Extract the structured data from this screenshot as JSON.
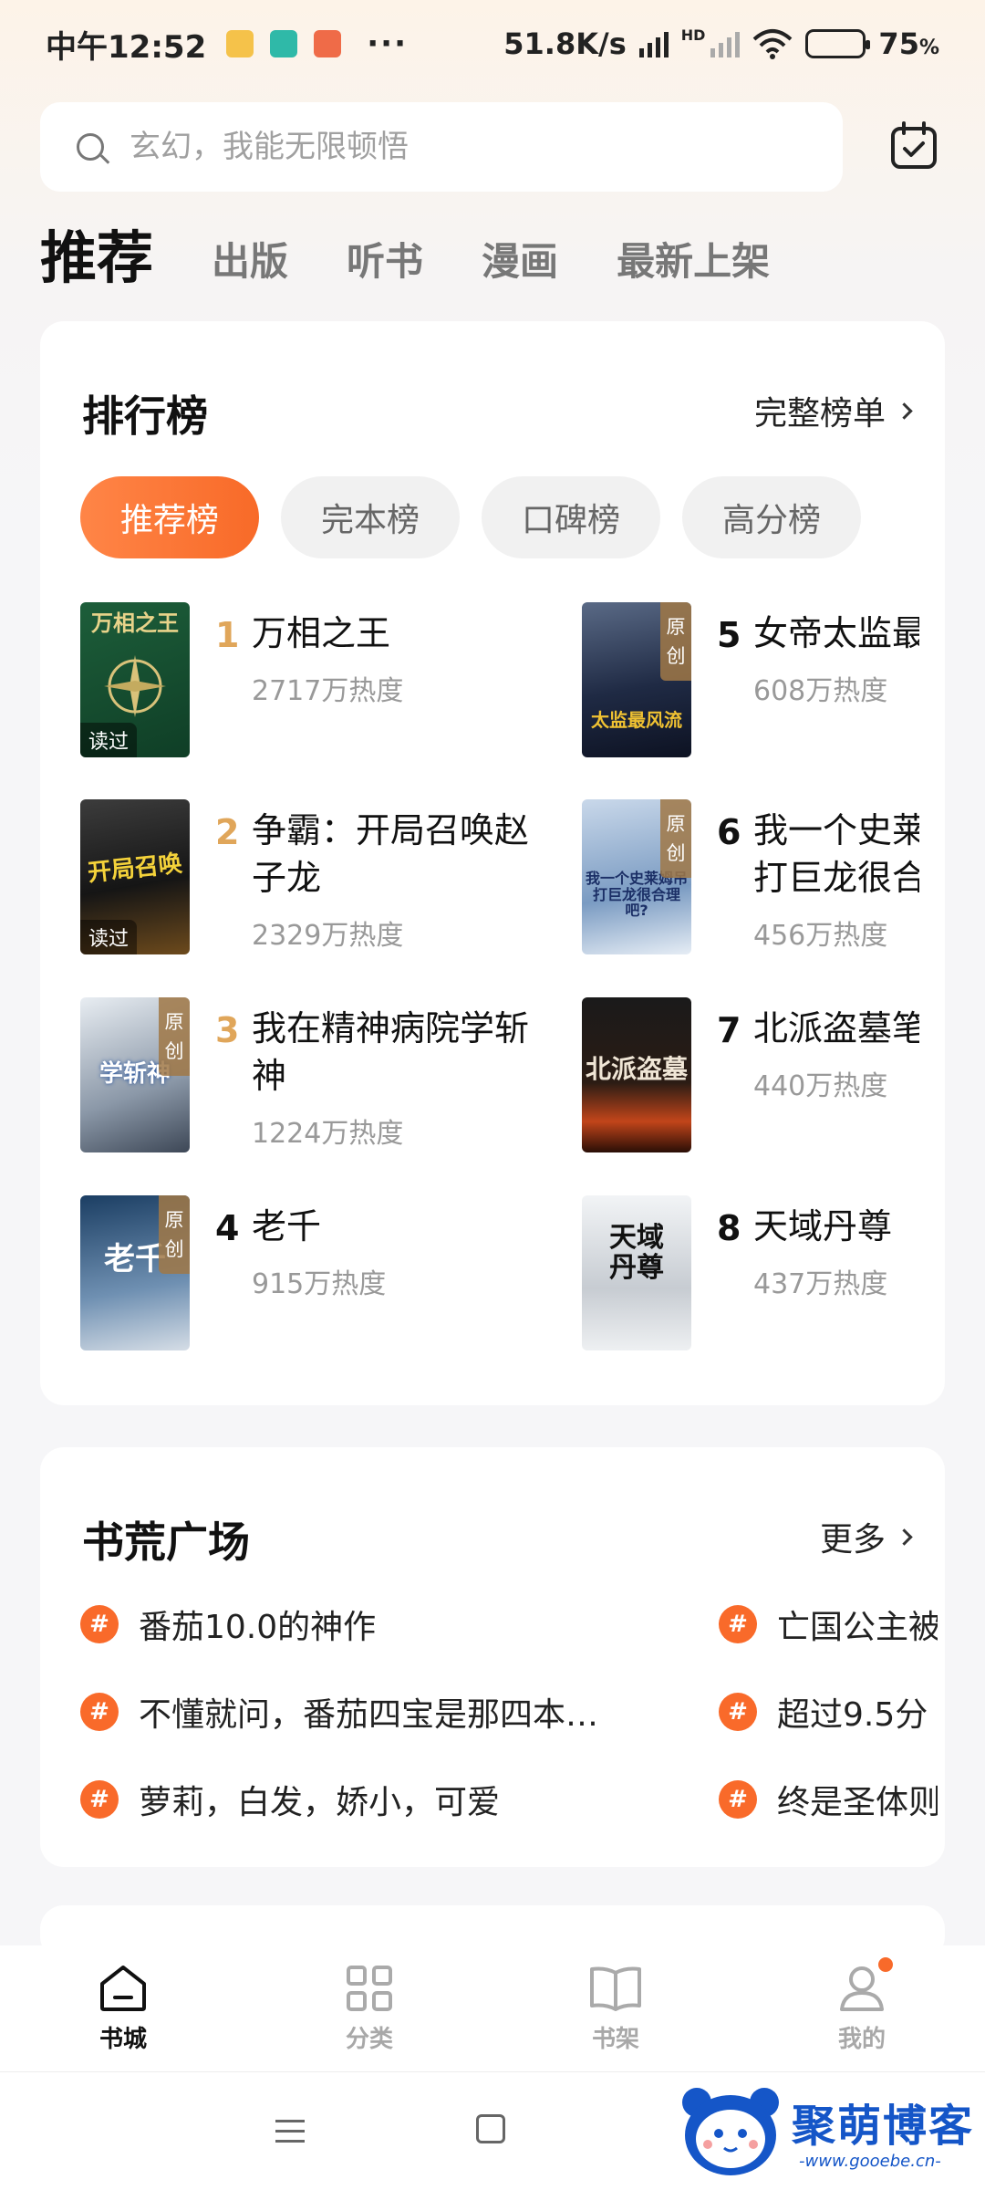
{
  "status_bar": {
    "time": "中午12:52",
    "app_icons": [
      "note-icon",
      "boss-icon",
      "gift-icon"
    ],
    "dots": "···",
    "network_speed": "51.8K/s",
    "network_type": "HD",
    "battery_percent": "75",
    "battery_unit": "%",
    "battery_level": 0.75
  },
  "search": {
    "placeholder": "玄幻，我能无限顿悟"
  },
  "tabs": [
    {
      "label": "推荐",
      "active": true
    },
    {
      "label": "出版"
    },
    {
      "label": "听书"
    },
    {
      "label": "漫画"
    },
    {
      "label": "最新上架"
    }
  ],
  "ranking": {
    "title": "排行榜",
    "more_label": "完整榜单",
    "pills": [
      "推荐榜",
      "完本榜",
      "口碑榜",
      "高分榜"
    ],
    "active_pill": 0,
    "books": [
      {
        "rank": "1",
        "name": "万相之王",
        "heat": "2717万热度",
        "badge": "读过",
        "cover_title": "万相之王"
      },
      {
        "rank": "2",
        "name": "争霸：开局召唤赵子龙",
        "heat": "2329万热度",
        "badge": "读过",
        "cover_title": "开局召唤"
      },
      {
        "rank": "3",
        "name": "我在精神病院学斩神",
        "heat": "1224万热度",
        "badge": "原创",
        "cover_title": "学斩神"
      },
      {
        "rank": "4",
        "name": "老千",
        "heat": "915万热度",
        "badge": "原创",
        "cover_title": "老千"
      },
      {
        "rank": "5",
        "name": "女帝太监最",
        "heat": "608万热度",
        "badge": "原创",
        "cover_title": "太监最风流"
      },
      {
        "rank": "6",
        "name": "我一个史莱打巨龙很合",
        "heat": "456万热度",
        "badge": "原创",
        "cover_title": "我一个史莱姆吊打巨龙很合理吧?"
      },
      {
        "rank": "7",
        "name": "北派盗墓笔",
        "heat": "440万热度",
        "badge": "",
        "cover_title": "北派盗墓"
      },
      {
        "rank": "8",
        "name": "天域丹尊",
        "heat": "437万热度",
        "badge": "",
        "cover_title": "天域丹尊"
      }
    ]
  },
  "square": {
    "title": "书荒广场",
    "more_label": "更多",
    "hash_symbol": "#",
    "topics": [
      "番茄10.0的神作",
      "不懂就问，番茄四宝是那四本…",
      "萝莉，白发，娇小，可爱",
      "亡国公主被",
      "超过9.5分",
      "终是圣体则"
    ]
  },
  "bottom_nav": [
    {
      "label": "书城",
      "icon": "home-icon",
      "active": true
    },
    {
      "label": "分类",
      "icon": "grid-icon"
    },
    {
      "label": "书架",
      "icon": "book-icon"
    },
    {
      "label": "我的",
      "icon": "user-icon",
      "has_dot": true
    }
  ],
  "watermark": {
    "title": "聚萌博客",
    "url": "-www.gooebe.cn-"
  },
  "colors": {
    "accent": "#f86a28",
    "rank_top": "#e0a65a",
    "watermark_blue": "#1556c8"
  }
}
